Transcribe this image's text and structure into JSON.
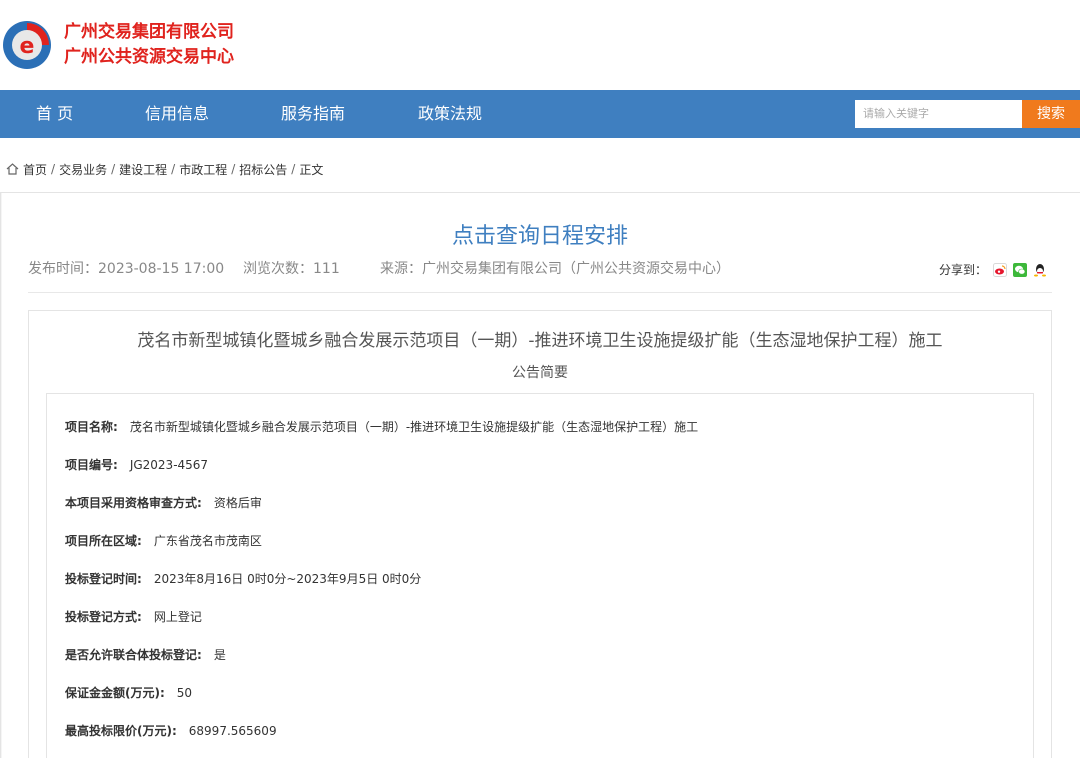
{
  "header": {
    "org_name_1": "广州交易集团有限公司",
    "org_name_2": "广州公共资源交易中心"
  },
  "nav": {
    "items": [
      "首 页",
      "信用信息",
      "服务指南",
      "政策法规"
    ],
    "search_placeholder": "请输入关键字",
    "search_label": "搜索"
  },
  "breadcrumb": {
    "items": [
      "首页",
      "交易业务",
      "建设工程",
      "市政工程",
      "招标公告",
      "正文"
    ],
    "separator": "/"
  },
  "article": {
    "title": "点击查询日程安排",
    "publish_time": "发布时间：2023-08-15 17:00",
    "view_count": "浏览次数：111",
    "source": "来源：广州交易集团有限公司（广州公共资源交易中心）",
    "share_label": "分享到："
  },
  "content": {
    "project_title": "茂名市新型城镇化暨城乡融合发展示范项目（一期）-推进环境卫生设施提级扩能（生态湿地保护工程）施工",
    "subtitle": "公告简要",
    "fields": [
      {
        "label": "项目名称:",
        "value": "茂名市新型城镇化暨城乡融合发展示范项目（一期）-推进环境卫生设施提级扩能（生态湿地保护工程）施工"
      },
      {
        "label": "项目编号:",
        "value": "JG2023-4567"
      },
      {
        "label": "本项目采用资格审查方式:",
        "value": "资格后审"
      },
      {
        "label": "项目所在区域:",
        "value": "广东省茂名市茂南区"
      },
      {
        "label": "投标登记时间:",
        "value": "2023年8月16日 0时0分~2023年9月5日 0时0分"
      },
      {
        "label": "投标登记方式:",
        "value": "网上登记"
      },
      {
        "label": "是否允许联合体投标登记:",
        "value": "是"
      },
      {
        "label": "保证金金额(万元):",
        "value": "50"
      },
      {
        "label": "最高投标限价(万元):",
        "value": "68997.565609"
      }
    ]
  },
  "colors": {
    "brand_red": "#e0231e",
    "nav_blue": "#3f7fc0",
    "search_orange": "#f07a1d"
  }
}
